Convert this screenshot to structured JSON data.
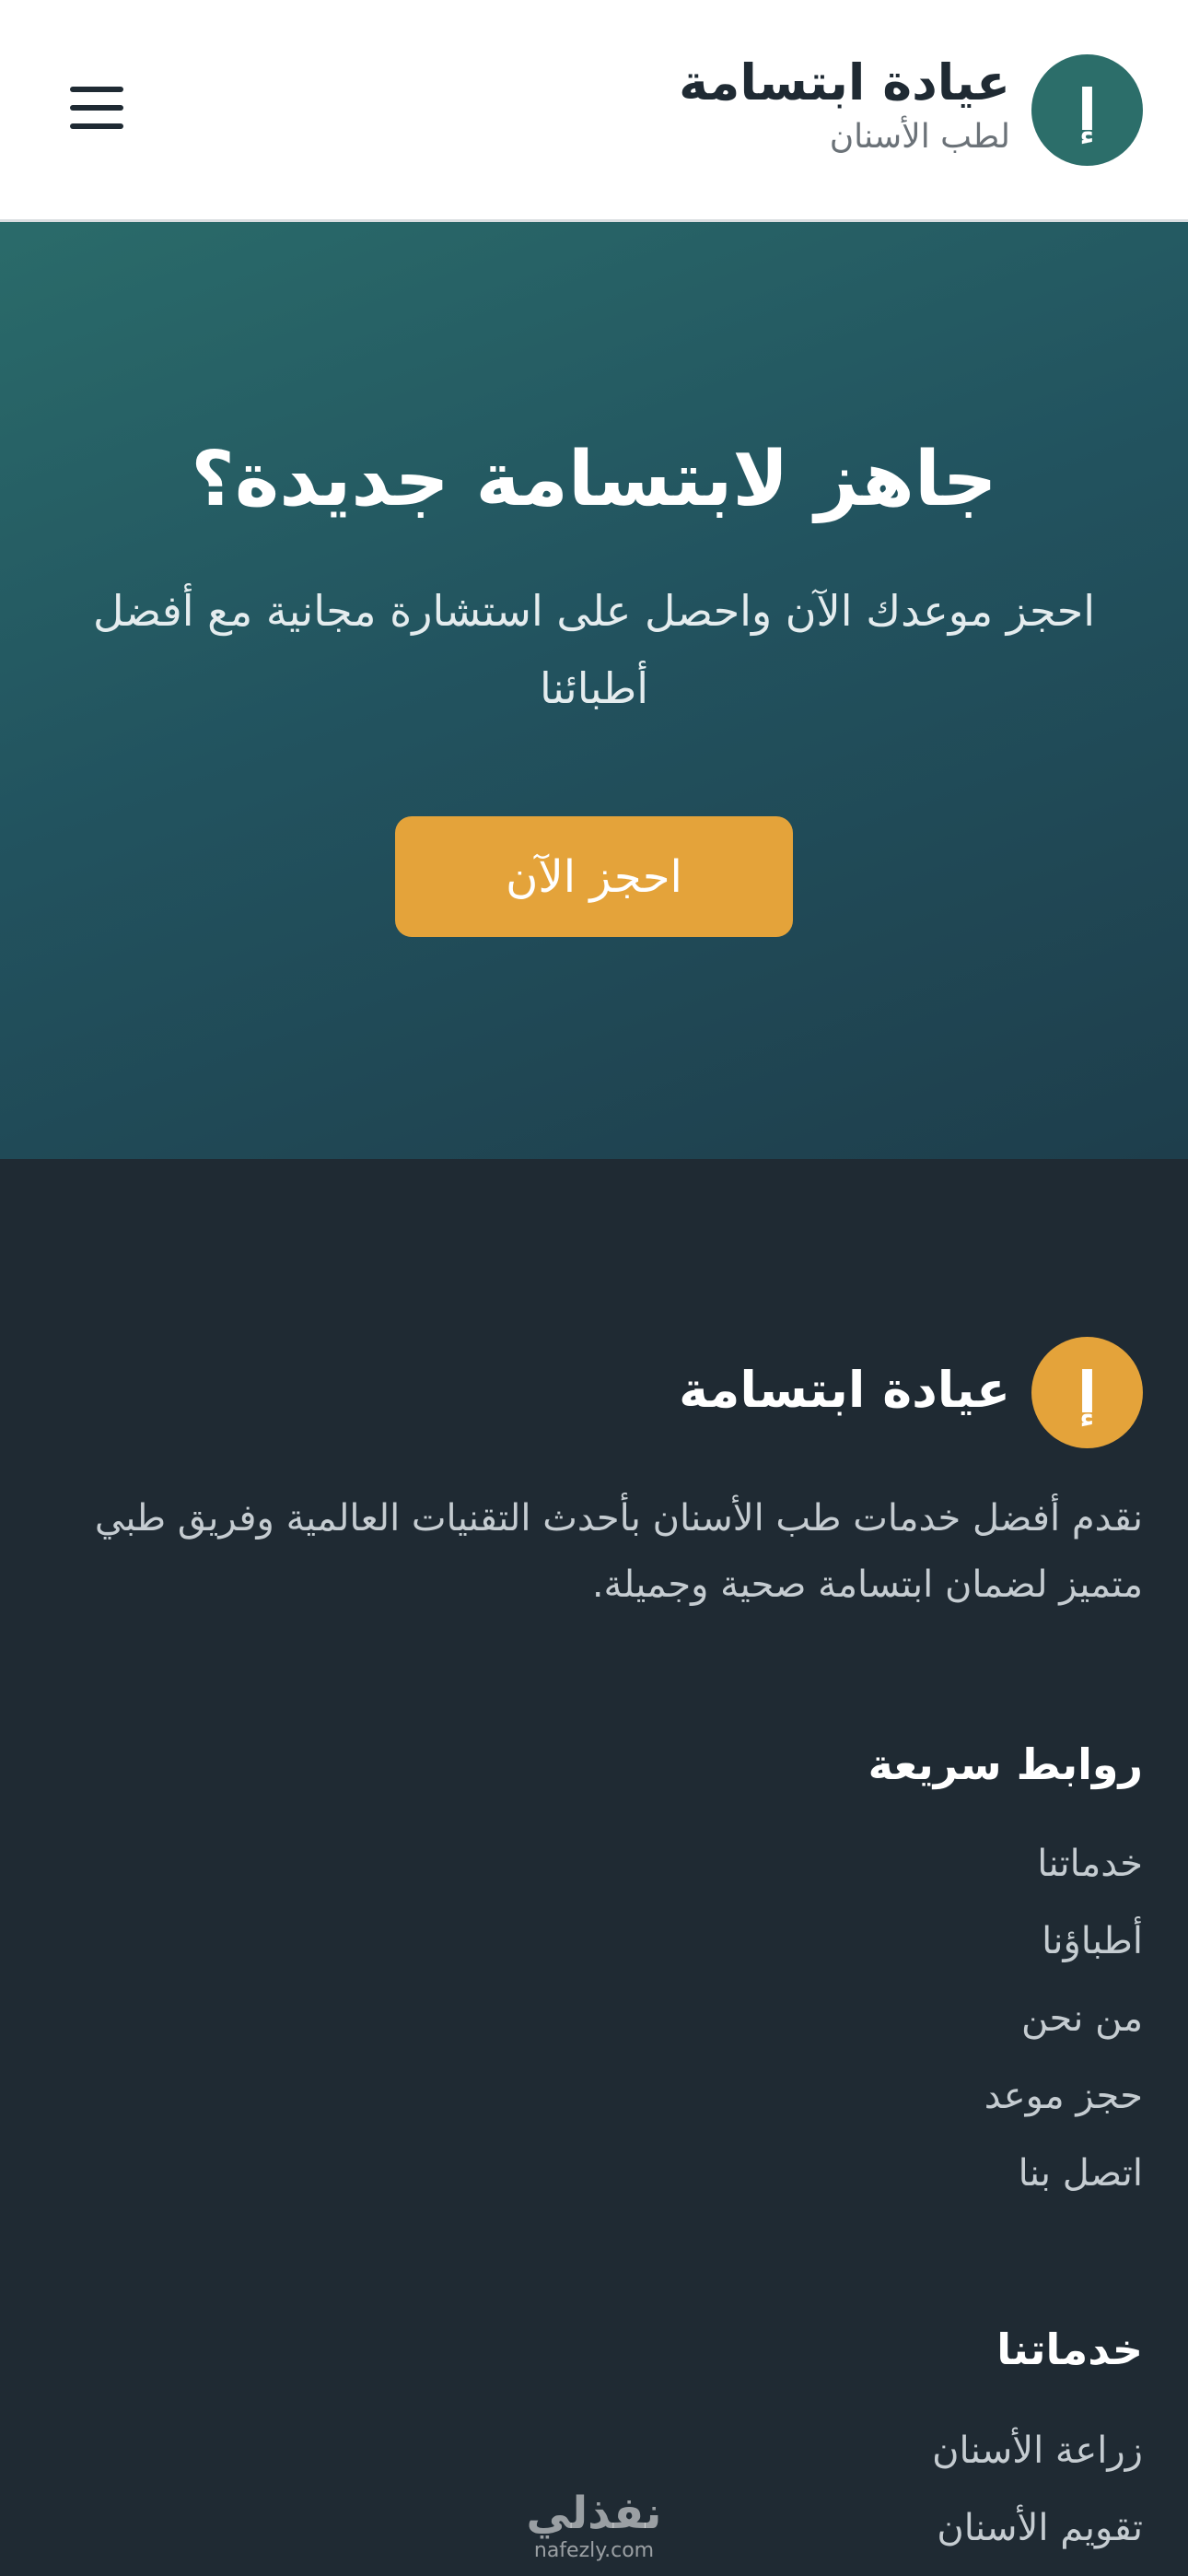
{
  "header": {
    "logo_glyph": "إ",
    "title": "عيادة ابتسامة",
    "subtitle": "لطب الأسنان",
    "menu_icon": "hamburger-menu-icon"
  },
  "hero": {
    "title": "جاهز لابتسامة جديدة؟",
    "text": "احجز موعدك الآن واحصل على استشارة مجانية مع أفضل أطبائنا",
    "cta_label": "احجز الآن"
  },
  "footer": {
    "logo_glyph": "إ",
    "brand": "عيادة ابتسامة",
    "description": "نقدم أفضل خدمات طب الأسنان بأحدث التقنيات العالمية وفريق طبي متميز لضمان ابتسامة صحية وجميلة.",
    "quick_links_title": "روابط سريعة",
    "quick_links": [
      "خدماتنا",
      "أطباؤنا",
      "من نحن",
      "حجز موعد",
      "اتصل بنا"
    ],
    "services_title": "خدماتنا",
    "services": [
      "زراعة الأسنان",
      "تقويم الأسنان"
    ]
  },
  "watermark": {
    "arabic": "نفذلي",
    "latin": "nafezly.com"
  },
  "colors": {
    "primary": "#2c6e6a",
    "accent": "#e4a33a",
    "footer_bg": "#1f2a33"
  }
}
